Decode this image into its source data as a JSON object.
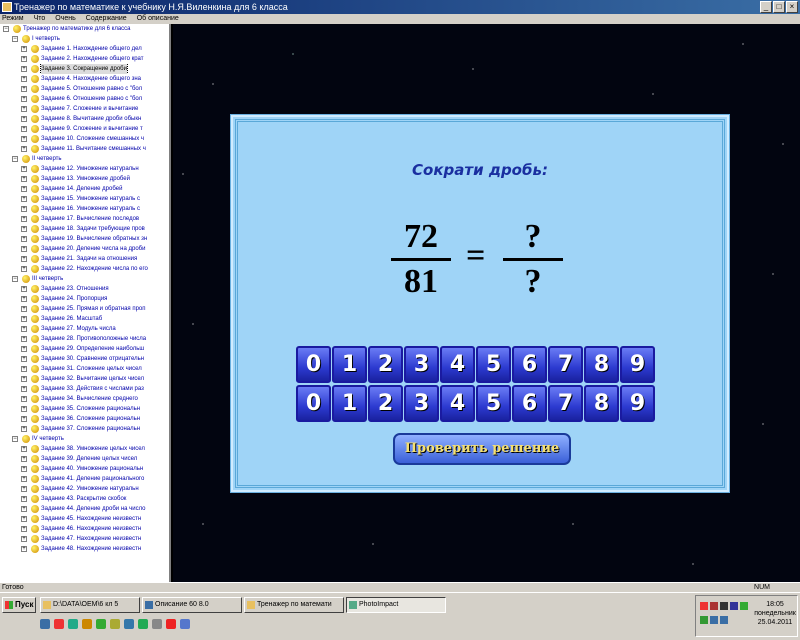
{
  "window": {
    "title": "Тренажер по математике к учебнику Н.Я.Виленкина для 6 класса",
    "controls": [
      "_",
      "□",
      "×"
    ]
  },
  "menu": [
    "Режим",
    "Что",
    "Очень",
    "Содержание",
    "Об описание"
  ],
  "tree": {
    "root": "Тренажер по математике для 6 класса",
    "quarters": [
      {
        "label": "I четверть",
        "tasks": [
          "Задание 1. Нахождение общего дел",
          "Задание 2. Нахождение общего крат",
          "Задание 3. Сокращение дроби",
          "Задание 4. Нахождение общего зна",
          "Задание 5. Отношение равно с \"бол",
          "Задание 6. Отношение равно с \"бол",
          "Задание 7. Сложение и вычитание",
          "Задание 8. Вычитание дроби обыкн",
          "Задание 9. Сложение и вычитание т",
          "Задание 10. Сложение смешанных ч",
          "Задание 11. Вычитание смешанных ч"
        ]
      },
      {
        "label": "II четверть",
        "tasks": [
          "Задание 12. Умножение натуральн",
          "Задание 13. Умножение дробей",
          "Задание 14. Деление дробей",
          "Задание 15. Умножение натураль с",
          "Задание 16. Умножение натураль с",
          "Задание 17. Вычисление последов",
          "Задание 18. Задачи требующие пров",
          "Задание 19. Вычисление обратных зн",
          "Задание 20. Деление числа на дроби",
          "Задание 21. Задачи на отношения",
          "Задание 22. Нахождение числа по его"
        ]
      },
      {
        "label": "III четверть",
        "tasks": [
          "Задание 23. Отношения",
          "Задание 24. Пропорция",
          "Задание 25. Прямая и обратная проп",
          "Задание 26. Масштаб",
          "Задание 27. Модуль числа",
          "Задание 28. Противоположные числа",
          "Задание 29. Определение наибольш",
          "Задание 30. Сравнение отрицательн",
          "Задание 31. Сложение целых чисел",
          "Задание 32. Вычитание целых чисел",
          "Задание 33. Действия с числами раз",
          "Задание 34. Вычисление среднего",
          "Задание 35. Сложение рациональн",
          "Задание 36. Сложение рациональн",
          "Задание 37. Сложение рациональн"
        ]
      },
      {
        "label": "IV четверть",
        "tasks": [
          "Задание 38. Умножение целых чисел",
          "Задание 39. Деление целых чисел",
          "Задание 40. Умножение рациональн",
          "Задание 41. Деление рационального",
          "Задание 42. Умножение натуральн",
          "Задание 43. Раскрытие скобок",
          "Задание 44. Деление дроби на число",
          "Задание 45. Нахождение неизвестн",
          "Задание 46. Нахождение неизвестн",
          "Задание 47. Нахождение неизвестн",
          "Задание 48. Нахождение неизвестн"
        ]
      }
    ]
  },
  "exercise": {
    "title": "Сократи дробь:",
    "left_numerator": "72",
    "left_denominator": "81",
    "equals": "=",
    "right_numerator": "?",
    "right_denominator": "?",
    "digits_row1": [
      "0",
      "1",
      "2",
      "3",
      "4",
      "5",
      "6",
      "7",
      "8",
      "9"
    ],
    "digits_row2": [
      "0",
      "1",
      "2",
      "3",
      "4",
      "5",
      "6",
      "7",
      "8",
      "9"
    ],
    "check_label": "Проверить решение"
  },
  "status": {
    "left": "Готово",
    "right": "NUM"
  },
  "taskbar": {
    "start_label": "Пуск",
    "buttons": [
      "D:\\DATA\\ОЕМ\\6 кл 5",
      "Описание 60 8.0",
      "Тренажер по математи",
      "PhotoImpact"
    ],
    "clock_time": "18:05",
    "clock_day": "понедельник",
    "clock_date": "25.04.2011"
  },
  "colors": {
    "panel_bg": "#9fd4f7",
    "title_color": "#1a2fa0",
    "digit_key": "#2c3ad0",
    "check_text": "#f5e070"
  }
}
